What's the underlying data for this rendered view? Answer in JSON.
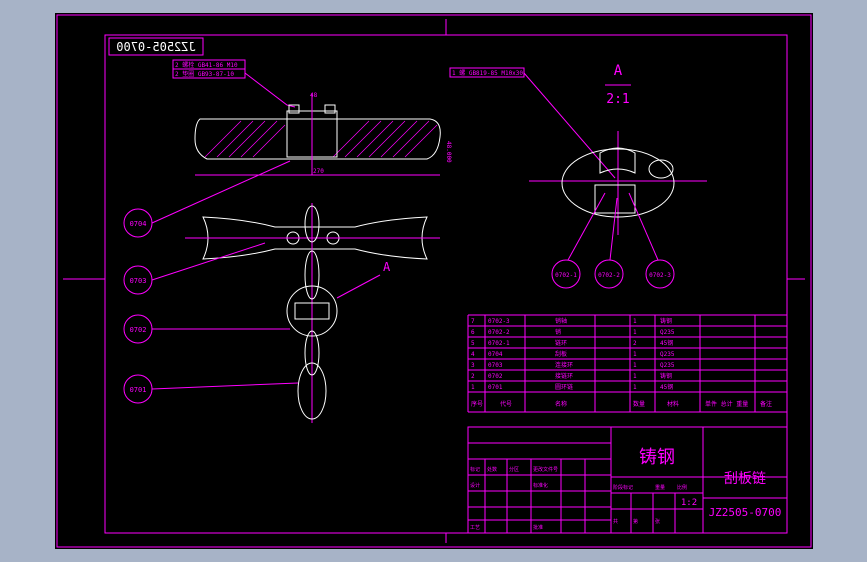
{
  "colors": {
    "background": "#a7b3c7",
    "canvas": "#000000",
    "linework": "#ff00ff",
    "geometry": "#ffffff"
  },
  "drawing_number_mirrored": "JZ2505-0700",
  "callouts": {
    "top_left_1": "2 螺栓 GB41-86 M10",
    "top_left_2": "2 垫圈 GB93-87-10",
    "top_right": "1 螺 GB819-85 M10x30",
    "dim_width": "270",
    "dim_top": "48",
    "dim_height": "48.000"
  },
  "view": {
    "label": "A",
    "scale": "2:1"
  },
  "balloons": [
    "0704",
    "0703",
    "0702",
    "0701",
    "0702-1",
    "0702-2",
    "0702-3"
  ],
  "section_marker": "A",
  "bom": {
    "rows": [
      {
        "no": "7",
        "code": "0702-3",
        "name": "销轴",
        "qty": "1",
        "mat": "铸钢"
      },
      {
        "no": "6",
        "code": "0702-2",
        "name": "销",
        "qty": "1",
        "mat": "Q235"
      },
      {
        "no": "5",
        "code": "0702-1",
        "name": "链环",
        "qty": "2",
        "mat": "45钢"
      },
      {
        "no": "4",
        "code": "0704",
        "name": "刮板",
        "qty": "1",
        "mat": "Q235"
      },
      {
        "no": "3",
        "code": "0703",
        "name": "连接环",
        "qty": "1",
        "mat": "Q235"
      },
      {
        "no": "2",
        "code": "0702",
        "name": "接链环",
        "qty": "1",
        "mat": "铸钢"
      },
      {
        "no": "1",
        "code": "0701",
        "name": "圆环链",
        "qty": "1",
        "mat": "45钢"
      }
    ],
    "header": {
      "no": "序号",
      "code": "代号",
      "name": "名称",
      "qty": "数量",
      "mat": "材料",
      "weight": "单件 总计 重量",
      "note": "备注"
    }
  },
  "title_block": {
    "material": "铸钢",
    "part_name": "刮板链",
    "scale": "1:2",
    "drawing_no": "JZ2505-0700",
    "labels": {
      "mark": "标记",
      "count": "处数",
      "zone": "分区",
      "change": "更改文件号",
      "design": "设计",
      "std": "标准化",
      "stage": "阶段标记",
      "weight": "重量",
      "ratio": "比例",
      "sheet": "共",
      "page": "第",
      "page_unit": "张",
      "approve": "批准",
      "craft": "工艺"
    }
  }
}
